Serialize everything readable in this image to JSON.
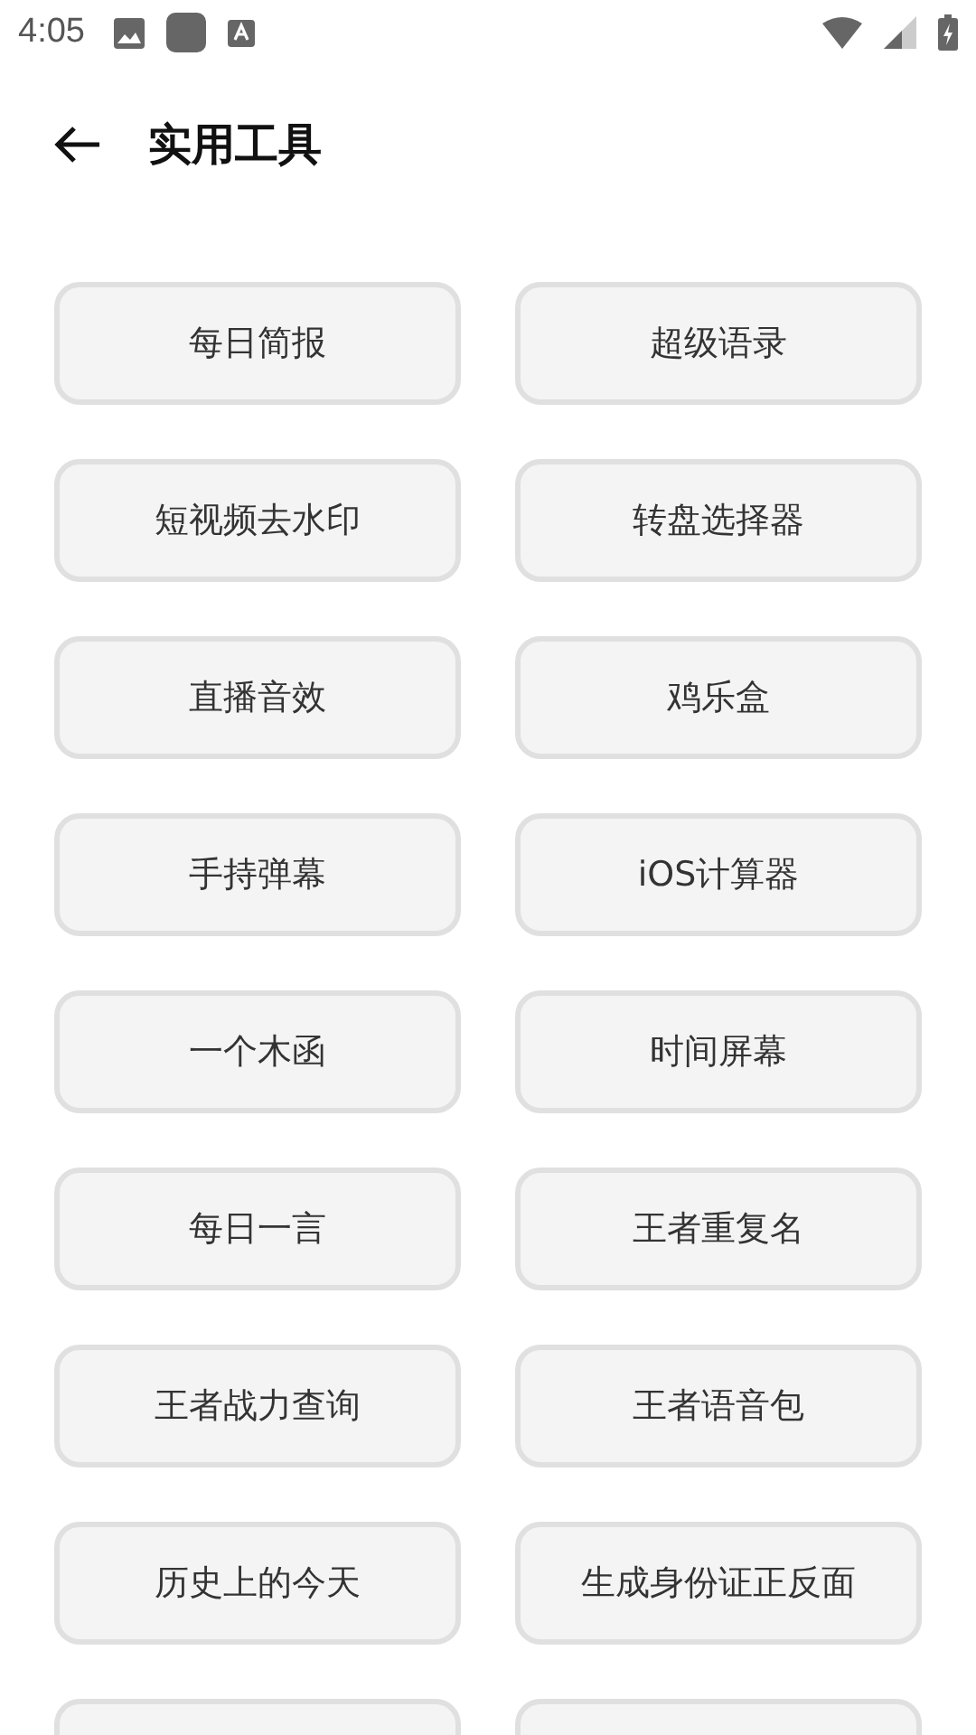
{
  "status_bar": {
    "time": "4:05"
  },
  "header": {
    "title": "实用工具"
  },
  "tools": [
    {
      "kind": "labelled",
      "label": "每日简报"
    },
    {
      "kind": "labelled",
      "label": "超级语录"
    },
    {
      "kind": "labelled",
      "label": "短视频去水印"
    },
    {
      "kind": "labelled",
      "label": "转盘选择器"
    },
    {
      "kind": "labelled",
      "label": "直播音效"
    },
    {
      "kind": "labelled",
      "label": "鸡乐盒"
    },
    {
      "kind": "labelled",
      "label": "手持弹幕"
    },
    {
      "kind": "labelled",
      "label": "iOS计算器"
    },
    {
      "kind": "labelled",
      "label": "一个木函"
    },
    {
      "kind": "labelled",
      "label": "时间屏幕"
    },
    {
      "kind": "labelled",
      "label": "每日一言"
    },
    {
      "kind": "labelled",
      "label": "王者重复名"
    },
    {
      "kind": "labelled",
      "label": "王者战力查询"
    },
    {
      "kind": "labelled",
      "label": "王者语音包"
    },
    {
      "kind": "labelled",
      "label": "历史上的今天"
    },
    {
      "kind": "labelled",
      "label": "生成身份证正反面"
    },
    {
      "kind": "cut"
    },
    {
      "kind": "cut"
    }
  ]
}
